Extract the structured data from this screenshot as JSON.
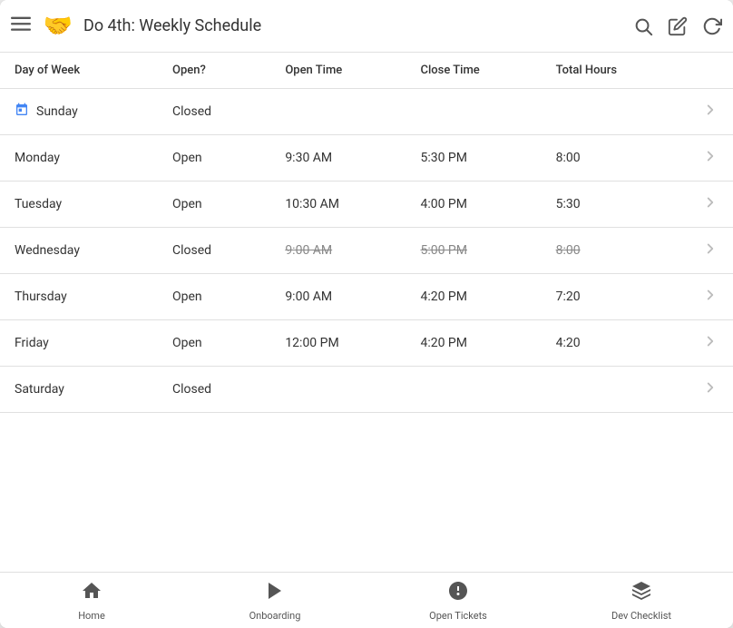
{
  "header": {
    "menu_icon": "☰",
    "logo_emoji": "🤝",
    "title": "Do 4th: Weekly Schedule",
    "search_icon": "search",
    "edit_icon": "edit",
    "refresh_icon": "refresh"
  },
  "table": {
    "columns": [
      "Day of Week",
      "Open?",
      "Open Time",
      "Close Time",
      "Total Hours"
    ],
    "rows": [
      {
        "day": "Sunday",
        "has_icon": true,
        "open_status": "Closed",
        "open_time": "",
        "close_time": "",
        "total_hours": "",
        "strikethrough": false
      },
      {
        "day": "Monday",
        "has_icon": false,
        "open_status": "Open",
        "open_time": "9:30 AM",
        "close_time": "5:30 PM",
        "total_hours": "8:00",
        "strikethrough": false
      },
      {
        "day": "Tuesday",
        "has_icon": false,
        "open_status": "Open",
        "open_time": "10:30 AM",
        "close_time": "4:00 PM",
        "total_hours": "5:30",
        "strikethrough": false
      },
      {
        "day": "Wednesday",
        "has_icon": false,
        "open_status": "Closed",
        "open_time": "9:00 AM",
        "close_time": "5:00 PM",
        "total_hours": "8:00",
        "strikethrough": true
      },
      {
        "day": "Thursday",
        "has_icon": false,
        "open_status": "Open",
        "open_time": "9:00 AM",
        "close_time": "4:20 PM",
        "total_hours": "7:20",
        "strikethrough": false
      },
      {
        "day": "Friday",
        "has_icon": false,
        "open_status": "Open",
        "open_time": "12:00 PM",
        "close_time": "4:20 PM",
        "total_hours": "4:20",
        "strikethrough": false
      },
      {
        "day": "Saturday",
        "has_icon": false,
        "open_status": "Closed",
        "open_time": "",
        "close_time": "",
        "total_hours": "",
        "strikethrough": false
      }
    ]
  },
  "bottom_nav": [
    {
      "label": "Home",
      "icon": "home"
    },
    {
      "label": "Onboarding",
      "icon": "play"
    },
    {
      "label": "Open Tickets",
      "icon": "ticket"
    },
    {
      "label": "Dev Checklist",
      "icon": "checklist"
    }
  ]
}
